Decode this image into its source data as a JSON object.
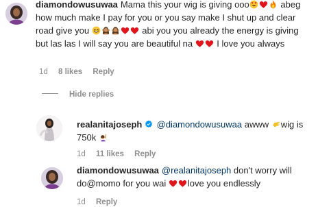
{
  "comments": [
    {
      "username": "diamondowusuwaa",
      "text_parts": {
        "t1": "Mama this your wig is giving ooo",
        "t2": " abeg how much make I pay for you or you say make I shut up and clear road give you ",
        "t3": " abi you you already the energy is giving but las las I will say you are beautiful na ",
        "t4": " I love you always"
      },
      "time": "1d",
      "likes": "8 likes",
      "reply": "Reply"
    }
  ],
  "hide_replies": "Hide replies",
  "replies": [
    {
      "username": "realanitajoseph",
      "mention": "@diamondowusuwaa",
      "text_parts": {
        "t1": " awww ",
        "t2": "wig is 750k "
      },
      "time": "1d",
      "likes": "11 likes",
      "reply": "Reply"
    },
    {
      "username": "diamondowusuwaa",
      "mention": "@realanitajoseph",
      "text_parts": {
        "t1": " don't worry will do@momo for you wai ",
        "t2": "love you endlessly"
      },
      "time": "1d",
      "reply": "Reply"
    }
  ],
  "colors": {
    "text": "#262626",
    "meta": "#8e8e8e",
    "mention": "#00376b",
    "verified": "#0095f6",
    "heart": "#ed1c24"
  },
  "icons": [
    "heart-eyes-emoji",
    "red-heart-emoji",
    "fire-emoji",
    "grinning-squint-emoji",
    "woman-gesturing-emoji",
    "waving-hand-emoji",
    "raising-hand-emoji",
    "verified-badge-icon"
  ]
}
